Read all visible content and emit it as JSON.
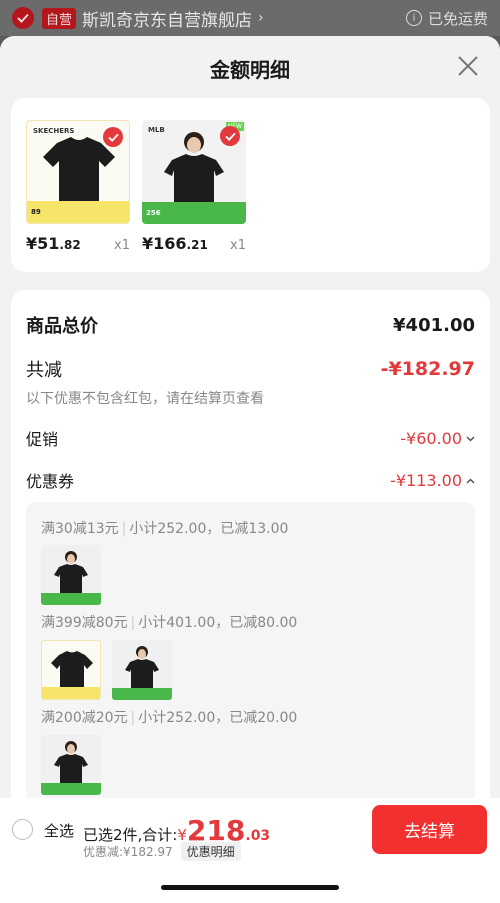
{
  "store": {
    "self_tag": "自营",
    "name": "斯凯奇京东自营旗舰店",
    "arrow": "›",
    "free_shipping": "已免运费",
    "info_glyph": "i"
  },
  "sheet": {
    "title": "金额明细"
  },
  "products": [
    {
      "brand": "SKECHERS",
      "mini_price": "89",
      "price_int": "¥51",
      "price_dec": ".82",
      "qty": "x1"
    },
    {
      "brand": "MLB",
      "new_tag": "NEW",
      "mini_price": "256",
      "price_int": "¥166",
      "price_dec": ".21",
      "qty": "x1"
    }
  ],
  "summary": {
    "total_label": "商品总价",
    "total_value": "¥401.00",
    "reduce_label": "共减",
    "reduce_value": "-¥182.97",
    "hint": "以下优惠不包含红包，请在结算页查看",
    "promo_label": "促销",
    "promo_value": "-¥60.00",
    "coupon_label": "优惠券",
    "coupon_value": "-¥113.00"
  },
  "coupons": [
    {
      "rule": "满30减13元",
      "detail": "小计252.00，已减13.00"
    },
    {
      "rule": "满399减80元",
      "detail": "小计401.00，已减80.00"
    },
    {
      "rule": "满200减20元",
      "detail": "小计252.00，已减20.00"
    }
  ],
  "bottom": {
    "select_all": "全选",
    "selected": "已选2件,合计:",
    "total_symbol": "¥",
    "total_int": "218",
    "total_dec": ".03",
    "discount": "优惠减:¥182.97",
    "detail_chip": "优惠明细",
    "checkout": "去结算"
  },
  "colors": {
    "accent": "#e4393c",
    "checkout": "#f23030"
  }
}
